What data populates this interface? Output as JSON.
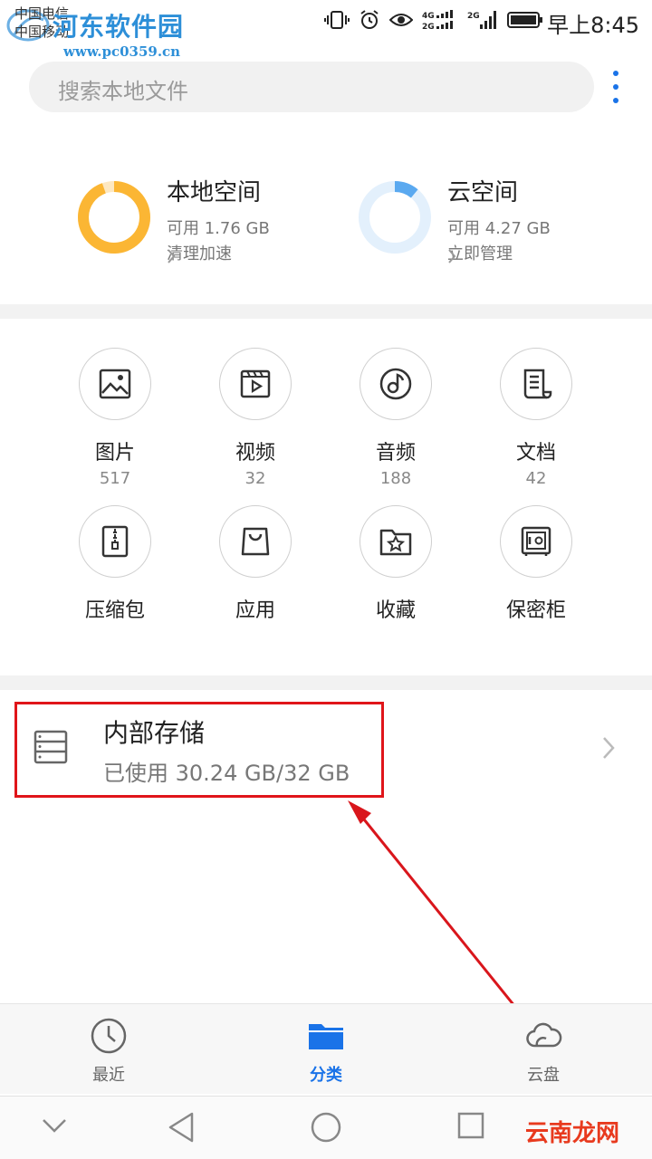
{
  "status_bar": {
    "carrier_1": "中国电信",
    "carrier_2": "中国移动",
    "watermark_title": "河东软件园",
    "watermark_url": "www.pc0359.cn",
    "time": "早上8:45",
    "icons": [
      "vibrate-icon",
      "alarm-icon",
      "eye-comfort-icon",
      "signal-4g-icon",
      "signal-2g-icon",
      "battery-icon"
    ]
  },
  "search": {
    "placeholder": "搜索本地文件"
  },
  "storage": {
    "local": {
      "title": "本地空间",
      "available": "可用 1.76 GB",
      "action": "清理加速",
      "used_fraction": 0.945,
      "color": "#fbb634",
      "remaining_color": "#fde8c2"
    },
    "cloud": {
      "title": "云空间",
      "available": "可用 4.27 GB",
      "action": "立即管理",
      "used_fraction": 0.11,
      "color": "#5aa9f0",
      "remaining_color": "#e3f0fc"
    }
  },
  "categories": [
    {
      "label": "图片",
      "count": "517",
      "icon": "image-icon"
    },
    {
      "label": "视频",
      "count": "32",
      "icon": "video-icon"
    },
    {
      "label": "音频",
      "count": "188",
      "icon": "music-icon"
    },
    {
      "label": "文档",
      "count": "42",
      "icon": "document-icon"
    },
    {
      "label": "压缩包",
      "count": "",
      "icon": "archive-icon"
    },
    {
      "label": "应用",
      "count": "",
      "icon": "app-bag-icon"
    },
    {
      "label": "收藏",
      "count": "",
      "icon": "favorite-folder-icon"
    },
    {
      "label": "保密柜",
      "count": "",
      "icon": "safe-icon"
    }
  ],
  "internal_storage": {
    "title": "内部存储",
    "usage": "已使用 30.24 GB/32 GB"
  },
  "tabs": [
    {
      "label": "最近",
      "icon": "clock-icon",
      "active": false
    },
    {
      "label": "分类",
      "icon": "folder-icon",
      "active": true
    },
    {
      "label": "云盘",
      "icon": "cloud-icon",
      "active": false
    }
  ],
  "nav_watermark": "云南龙网",
  "colors": {
    "accent": "#1a73e8",
    "highlight_box": "#e0151a",
    "arrow": "#d9161c"
  }
}
